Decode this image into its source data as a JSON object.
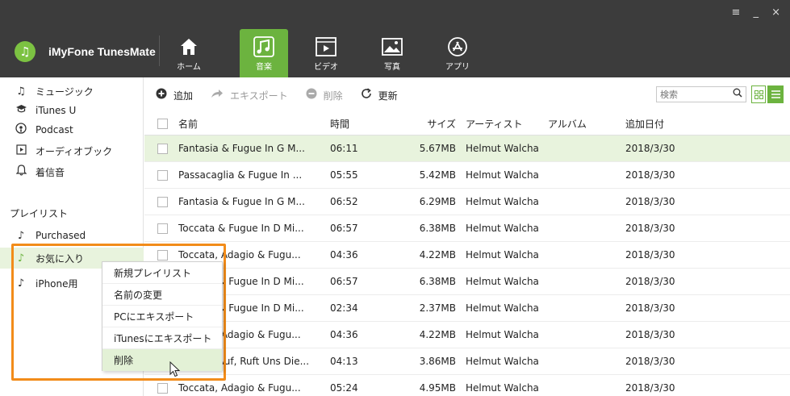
{
  "window": {
    "controls": "≡ _ ×"
  },
  "brand": {
    "logo_glyph": "♫",
    "name": "iMyFone TunesMate"
  },
  "nav_tabs": [
    {
      "label": "ホーム",
      "icon": "home-icon",
      "active": false
    },
    {
      "label": "音楽",
      "icon": "music-icon",
      "active": true
    },
    {
      "label": "ビデオ",
      "icon": "video-icon",
      "active": false
    },
    {
      "label": "写真",
      "icon": "photo-icon",
      "active": false
    },
    {
      "label": "アプリ",
      "icon": "app-store-icon",
      "active": false
    }
  ],
  "sidebar": {
    "items": [
      {
        "label": "ミュージック",
        "icon": "music-note-icon"
      },
      {
        "label": "iTunes U",
        "icon": "graduation-cap-icon"
      },
      {
        "label": "Podcast",
        "icon": "podcast-icon"
      },
      {
        "label": "オーディオブック",
        "icon": "audiobook-icon"
      },
      {
        "label": "着信音",
        "icon": "bell-icon"
      }
    ],
    "playlist_heading": "プレイリスト",
    "playlists": [
      {
        "label": "Purchased",
        "icon": "note-icon",
        "selected": false
      },
      {
        "label": "お気に入り",
        "icon": "note-icon",
        "selected": true
      },
      {
        "label": "iPhone用",
        "icon": "note-icon",
        "selected": false
      }
    ]
  },
  "toolbar": {
    "add_label": "追加",
    "export_label": "エキスポート",
    "delete_label": "削除",
    "refresh_label": "更新",
    "search_placeholder": "検索"
  },
  "table": {
    "columns": [
      "名前",
      "時間",
      "サイズ",
      "アーティスト",
      "アルバム",
      "追加日付"
    ],
    "rows": [
      {
        "name": "Fantasia & Fugue In G M...",
        "time": "06:11",
        "size": "5.67MB",
        "artist": "Helmut Walcha",
        "album": "",
        "date": "2018/3/30",
        "selected": true
      },
      {
        "name": "Passacaglia & Fugue In ...",
        "time": "05:55",
        "size": "5.42MB",
        "artist": "Helmut Walcha",
        "album": "",
        "date": "2018/3/30",
        "selected": false
      },
      {
        "name": "Fantasia & Fugue In G M...",
        "time": "06:52",
        "size": "6.29MB",
        "artist": "Helmut Walcha",
        "album": "",
        "date": "2018/3/30",
        "selected": false
      },
      {
        "name": "Toccata & Fugue In D Mi...",
        "time": "06:57",
        "size": "6.38MB",
        "artist": "Helmut Walcha",
        "album": "",
        "date": "2018/3/30",
        "selected": false
      },
      {
        "name": "Toccata, Adagio & Fugu...",
        "time": "04:36",
        "size": "4.22MB",
        "artist": "Helmut Walcha",
        "album": "",
        "date": "2018/3/30",
        "selected": false
      },
      {
        "name": "Toccata & Fugue In D Mi...",
        "time": "06:57",
        "size": "6.38MB",
        "artist": "Helmut Walcha",
        "album": "",
        "date": "2018/3/30",
        "selected": false
      },
      {
        "name": "Toccata & Fugue In D Mi...",
        "time": "02:34",
        "size": "2.37MB",
        "artist": "Helmut Walcha",
        "album": "",
        "date": "2018/3/30",
        "selected": false
      },
      {
        "name": "Toccata, Adagio & Fugu...",
        "time": "04:36",
        "size": "4.22MB",
        "artist": "Helmut Walcha",
        "album": "",
        "date": "2018/3/30",
        "selected": false
      },
      {
        "name": "Wachet Auf, Ruft Uns Die...",
        "time": "04:13",
        "size": "3.86MB",
        "artist": "Helmut Walcha",
        "album": "",
        "date": "2018/3/30",
        "selected": false
      },
      {
        "name": "Toccata, Adagio & Fugu...",
        "time": "05:24",
        "size": "4.95MB",
        "artist": "Helmut Walcha",
        "album": "",
        "date": "2018/3/30",
        "selected": false
      }
    ]
  },
  "context_menu": {
    "items": [
      {
        "label": "新規プレイリスト",
        "hover": false
      },
      {
        "label": "名前の変更",
        "hover": false
      },
      {
        "label": "PCにエキスポート",
        "hover": false
      },
      {
        "label": "iTunesにエキスポート",
        "hover": false
      },
      {
        "label": "削除",
        "hover": true
      }
    ]
  },
  "colors": {
    "accent": "#6cb33f",
    "header_bg": "#3c3c3c",
    "highlight": "#f28c1a",
    "selected_row": "#e8f3dd"
  }
}
